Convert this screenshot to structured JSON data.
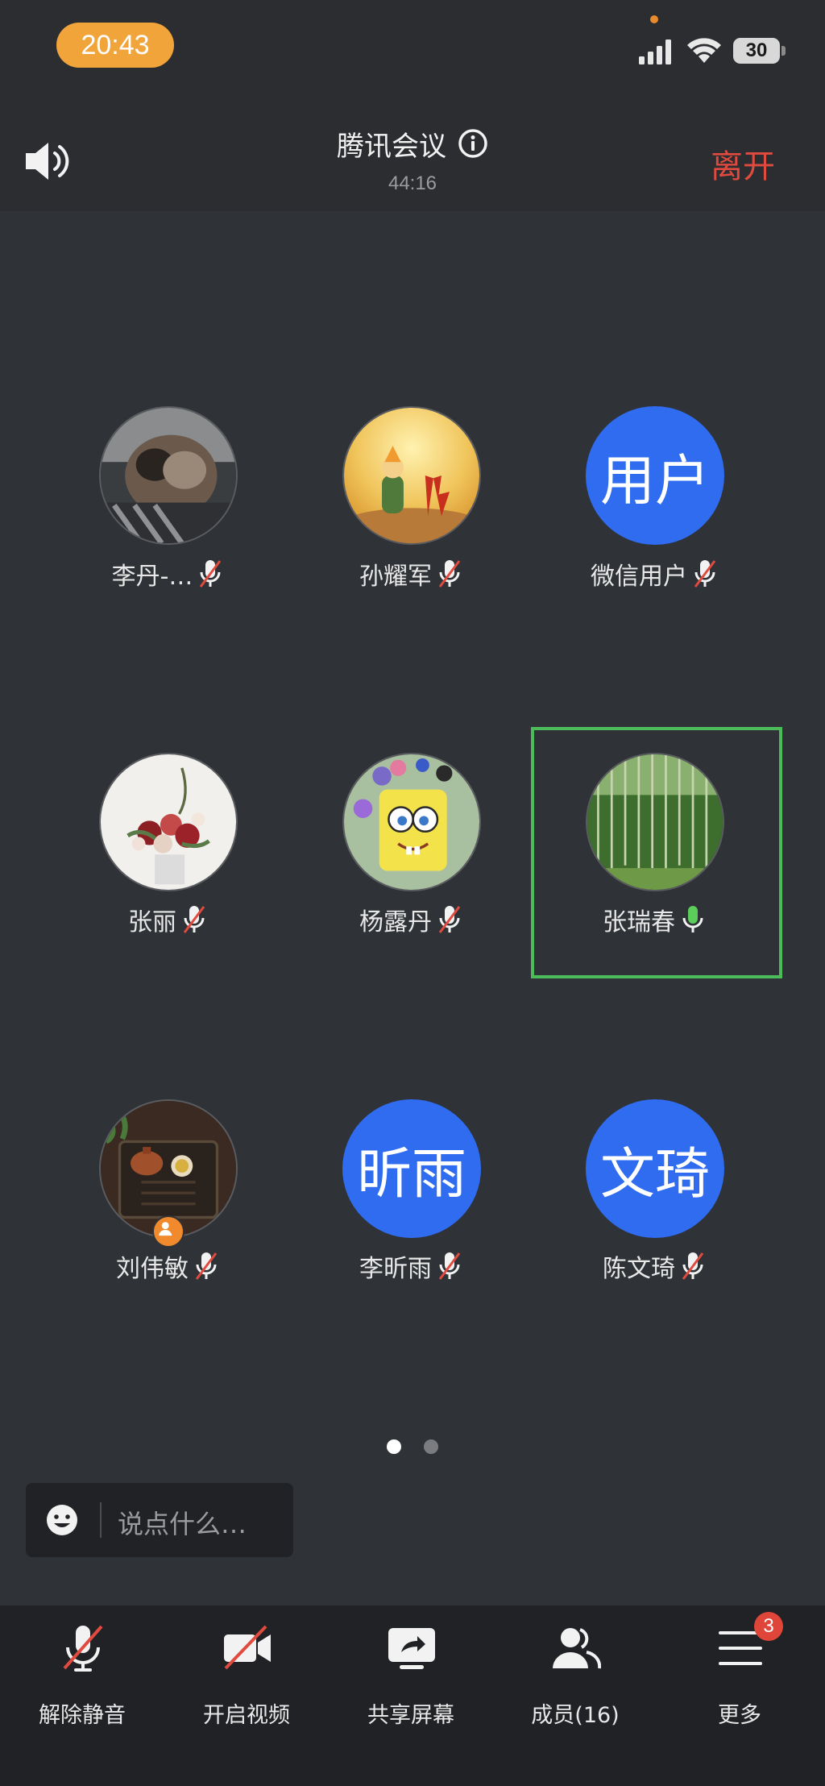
{
  "status_bar": {
    "time": "20:43",
    "battery": "30",
    "signal_icon": "cellular-signal-icon",
    "wifi_icon": "wifi-icon"
  },
  "header": {
    "title": "腾讯会议",
    "duration": "44:16",
    "leave_label": "离开",
    "speaker_icon": "speaker-icon",
    "info_icon": "info-icon"
  },
  "participants": [
    {
      "name": "李丹-…",
      "avatar": "photo",
      "muted": true
    },
    {
      "name": "孙耀军",
      "avatar": "photo",
      "muted": true
    },
    {
      "name": "微信用户",
      "avatar_text": "用户",
      "muted": true
    },
    {
      "name": "张丽",
      "avatar": "photo",
      "muted": true
    },
    {
      "name": "杨露丹",
      "avatar": "photo",
      "muted": true
    },
    {
      "name": "张瑞春",
      "avatar": "photo",
      "muted": false,
      "speaking": true
    },
    {
      "name": "刘伟敏",
      "avatar": "photo",
      "muted": true,
      "host": true
    },
    {
      "name": "李昕雨",
      "avatar_text": "昕雨",
      "muted": true
    },
    {
      "name": "陈文琦",
      "avatar_text": "文琦",
      "muted": true
    }
  ],
  "pager": {
    "pages": 2,
    "current": 1
  },
  "chat": {
    "placeholder": "说点什么…"
  },
  "toolbar": {
    "items": [
      {
        "label": "解除静音",
        "icon": "muted-microphone-icon"
      },
      {
        "label": "开启视频",
        "icon": "video-off-icon"
      },
      {
        "label": "共享屏幕",
        "icon": "share-screen-icon"
      },
      {
        "label": "成员(16)",
        "icon": "members-icon"
      },
      {
        "label": "更多",
        "icon": "more-menu-icon"
      }
    ],
    "more_badge": "3"
  },
  "colors": {
    "accent_blue": "#2f6cf0",
    "leave_red": "#e04a3f",
    "speaking_green": "#4cbb5a",
    "time_pill": "#f0a43a"
  }
}
